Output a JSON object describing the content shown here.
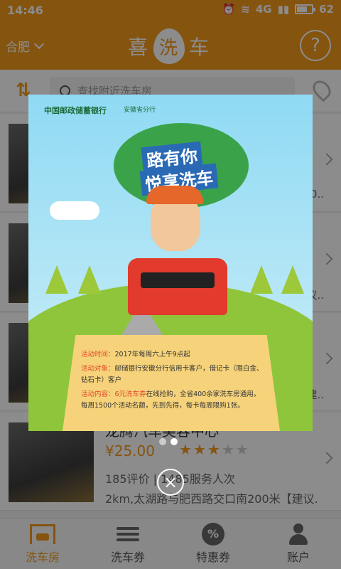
{
  "status": {
    "time": "14:46",
    "network": "4G",
    "battery": "62",
    "battery_level": 0.62
  },
  "header": {
    "city": "合肥",
    "logo_left": "喜",
    "logo_drop": "洗",
    "logo_right": "车",
    "help": "?"
  },
  "search": {
    "placeholder": "查找附近洗车房"
  },
  "list": {
    "items": [
      {
        "name": "",
        "price": "",
        "meta": "",
        "addr": "",
        "peek": "00.."
      },
      {
        "name": "",
        "price": "",
        "meta": "",
        "addr": "",
        "peek": "建议.."
      },
      {
        "name": "",
        "price": "",
        "meta": "",
        "addr": "",
        "peek": "建.."
      },
      {
        "name": "龙腾汽车美容中心",
        "price": "¥25.00",
        "rating": 3,
        "meta": "185评价 | 1485服务人次",
        "addr": "2km,太湖路与肥西路交口南200米【建议..",
        "peek": ""
      }
    ]
  },
  "tabs": [
    {
      "label": "洗车房",
      "icon": "garage-icon",
      "active": true
    },
    {
      "label": "洗车券",
      "icon": "list-icon",
      "active": false
    },
    {
      "label": "特惠券",
      "icon": "discount-icon",
      "active": false
    },
    {
      "label": "账户",
      "icon": "person-icon",
      "active": false
    }
  ],
  "ad": {
    "bank": "中国邮政储蓄银行",
    "branch": "安徽省分行",
    "slogan_line1": "路有你",
    "slogan_line2": "悦享洗车",
    "time_label": "活动时间：",
    "time_text": "2017年每周六上午9点起",
    "target_label": "活动对象：",
    "target_text": "邮储银行安徽分行信用卡客户，借记卡（限白金、钻石卡）客户",
    "content_label": "活动内容：",
    "content_highlight": "6元洗车券",
    "content_text": "在线抢购，全省400余家洗车房通用。每周1500个活动名额，先到先得，每卡每周限购1张。"
  },
  "pager": {
    "total": 2,
    "current": 2
  },
  "close_icon": "×",
  "colors": {
    "accent": "#f39a1d"
  }
}
